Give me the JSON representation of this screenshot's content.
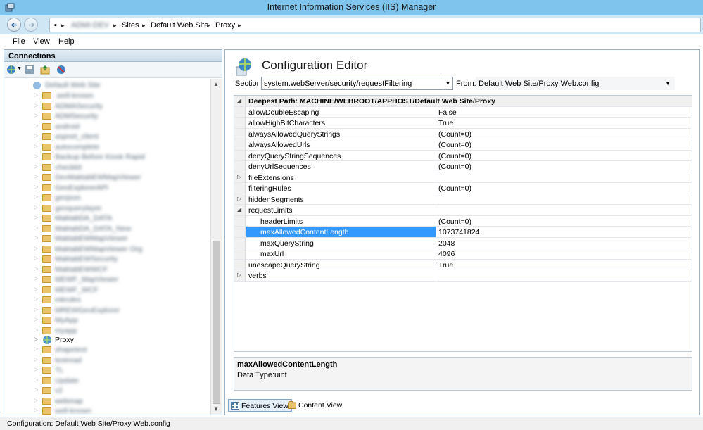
{
  "window": {
    "title": "Internet Information Services (IIS) Manager"
  },
  "address": {
    "server": "ADMI-DEV",
    "crumbs": [
      "Sites",
      "Default Web Site",
      "Proxy"
    ]
  },
  "menu": {
    "file": "File",
    "view": "View",
    "help": "Help"
  },
  "connections": {
    "header": "Connections",
    "root": "Default Web Site",
    "items": [
      ".well-known",
      "ADMASecurity",
      "ADMSecurity",
      "android",
      "aspnet_client",
      "autocomplete",
      "Backup Before Kiosk Rapid",
      "checkkit",
      "DevMaktabEWMapViewer",
      "GeoExplorerAPI",
      "geojson",
      "geoquerylayer",
      "MaktabDA_DATA",
      "MaktabDA_DATA_New",
      "MaktabEWMapViewer",
      "MaktabEWMapViewer Org",
      "MaktabEWSecurity",
      "MaktabEWWCF",
      "MEWF_MapViewer",
      "MEWF_WCF",
      "mkrules",
      "MREWGeoExplorer",
      "MyApp",
      "myapp"
    ],
    "selected": "Proxy",
    "after": [
      "shapetest",
      "testread",
      "TL",
      "Update",
      "v2",
      "webmap",
      "well-known"
    ]
  },
  "editor": {
    "title": "Configuration Editor",
    "section_label": "Section:",
    "section_value": "system.webServer/security/requestFiltering",
    "from_label": "From:",
    "from_value": "Default Web Site/Proxy Web.config",
    "deepest_path": "Deepest Path: MACHINE/WEBROOT/APPHOST/Default Web Site/Proxy",
    "rows": [
      {
        "name": "allowDoubleEscaping",
        "value": "False",
        "exp": ""
      },
      {
        "name": "allowHighBitCharacters",
        "value": "True",
        "exp": ""
      },
      {
        "name": "alwaysAllowedQueryStrings",
        "value": "(Count=0)",
        "exp": ""
      },
      {
        "name": "alwaysAllowedUrls",
        "value": "(Count=0)",
        "exp": ""
      },
      {
        "name": "denyQueryStringSequences",
        "value": "(Count=0)",
        "exp": ""
      },
      {
        "name": "denyUrlSequences",
        "value": "(Count=0)",
        "exp": ""
      },
      {
        "name": "fileExtensions",
        "value": "",
        "exp": "▷"
      },
      {
        "name": "filteringRules",
        "value": "(Count=0)",
        "exp": ""
      },
      {
        "name": "hiddenSegments",
        "value": "",
        "exp": "▷"
      },
      {
        "name": "requestLimits",
        "value": "",
        "exp": "◢"
      },
      {
        "name": "headerLimits",
        "value": "(Count=0)",
        "exp": "",
        "child": true
      },
      {
        "name": "maxAllowedContentLength",
        "value": "1073741824",
        "exp": "",
        "child": true,
        "selected": true
      },
      {
        "name": "maxQueryString",
        "value": "2048",
        "exp": "",
        "child": true
      },
      {
        "name": "maxUrl",
        "value": "4096",
        "exp": "",
        "child": true
      },
      {
        "name": "unescapeQueryString",
        "value": "True",
        "exp": ""
      },
      {
        "name": "verbs",
        "value": "",
        "exp": "▷"
      }
    ],
    "description_title": "maxAllowedContentLength",
    "description_type": "Data Type:uint"
  },
  "view_tabs": {
    "features": "Features View",
    "content": "Content View"
  },
  "status": {
    "text": "Configuration: Default Web Site/Proxy Web.config"
  },
  "colors": {
    "titlebar": "#7ec4ec",
    "selection": "#3399ff"
  }
}
